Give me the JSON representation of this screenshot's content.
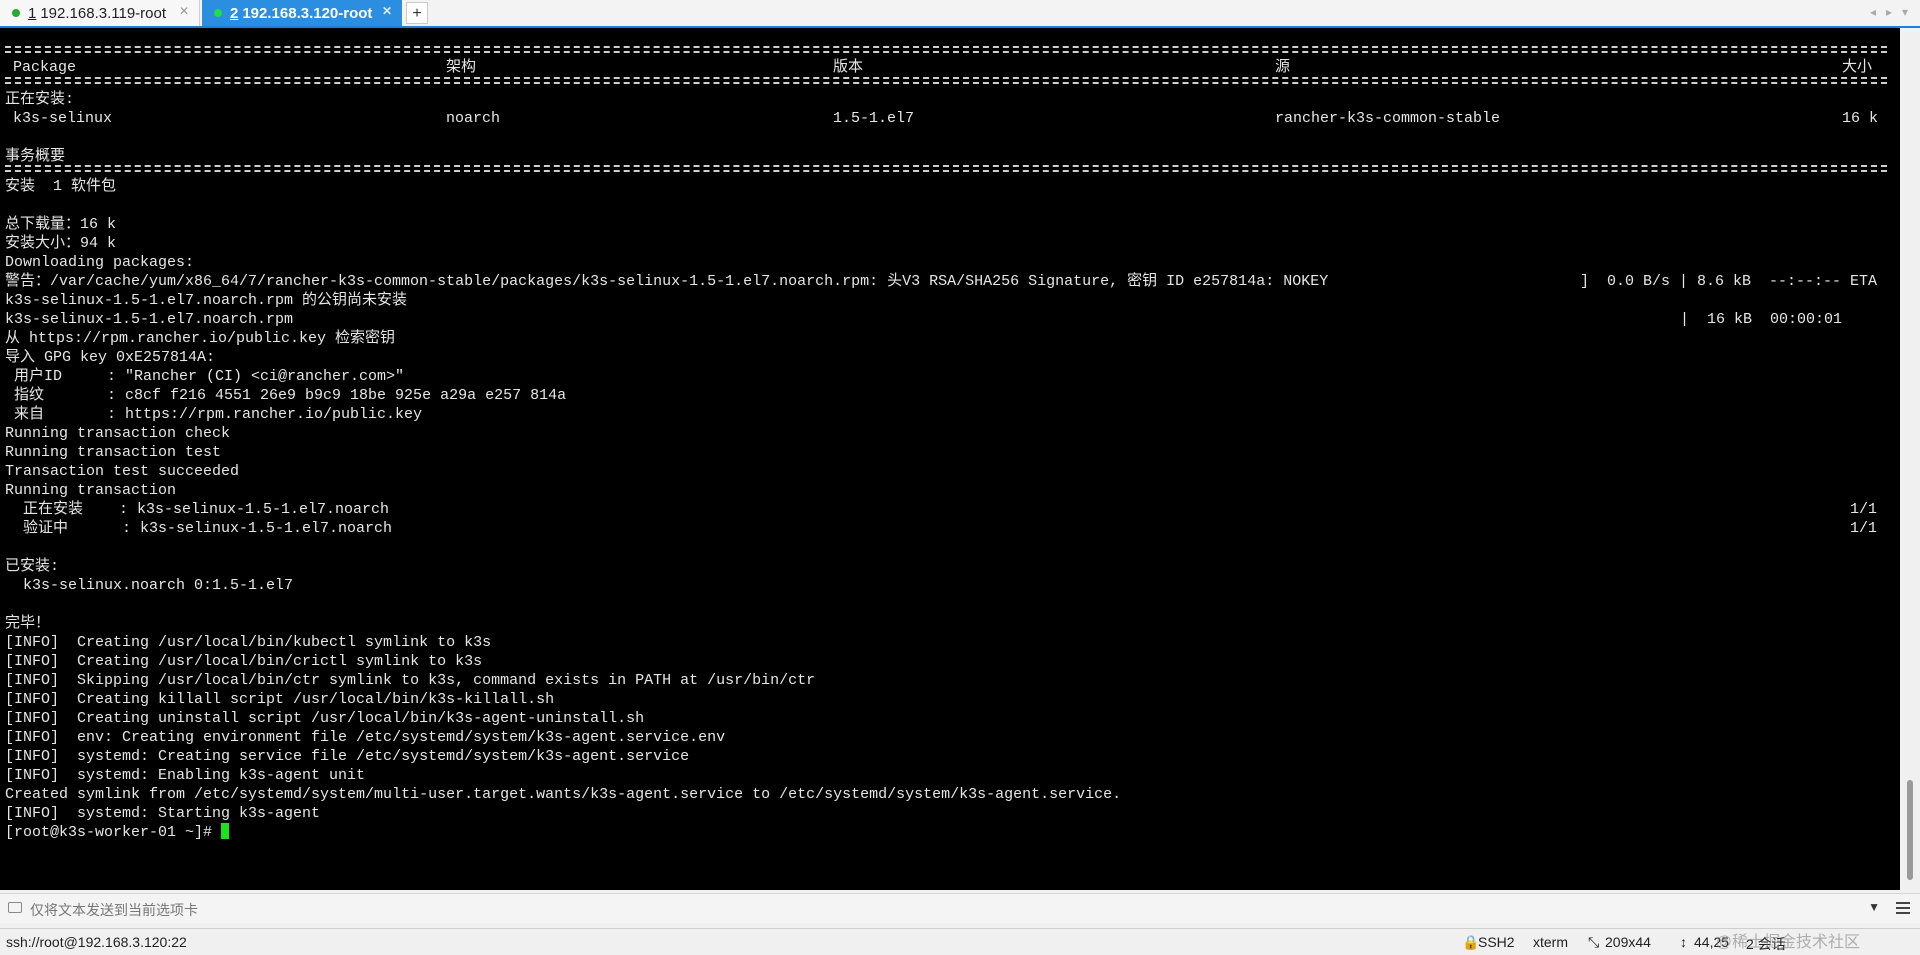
{
  "tabs": [
    {
      "number": "1",
      "label": "192.168.3.119-root"
    },
    {
      "number": "2",
      "label": "192.168.3.120-root"
    }
  ],
  "terminal": {
    "table_header": {
      "col1": "Package",
      "col2": "架构",
      "col3": "版本",
      "col4": "源",
      "col5": "大小"
    },
    "installing_label": "正在安装:",
    "package_row": {
      "col1": "k3s-selinux",
      "col2": "noarch",
      "col3": "1.5-1.el7",
      "col4": "rancher-k3s-common-stable",
      "col5": "16 k"
    },
    "summary_label": "事务概要",
    "install_count": "安装  1 软件包",
    "total_download": "总下载量：16 k",
    "install_size": "安装大小：94 k",
    "downloading": "Downloading packages:",
    "warning": "警告：/var/cache/yum/x86_64/7/rancher-k3s-common-stable/packages/k3s-selinux-1.5-1.el7.noarch.rpm: 头V3 RSA/SHA256 Signature, 密钥 ID e257814a: NOKEY",
    "warning_progress": "]  0.0 B/s | 8.6 kB  --:--:-- ETA",
    "pubkey_missing": "k3s-selinux-1.5-1.el7.noarch.rpm 的公钥尚未安装",
    "rpm_name": "k3s-selinux-1.5-1.el7.noarch.rpm",
    "rpm_progress": "|  16 kB  00:00:01",
    "retrieve_key": "从 https://rpm.rancher.io/public.key 检索密钥",
    "import_gpg": "导入 GPG key 0xE257814A:",
    "user_id": " 用户ID     : \"Rancher (CI) <ci@rancher.com>\"",
    "fingerprint": " 指纹       : c8cf f216 4551 26e9 b9c9 18be 925e a29a e257 814a",
    "from": " 来自       : https://rpm.rancher.io/public.key",
    "run_check": "Running transaction check",
    "run_test": "Running transaction test",
    "test_ok": "Transaction test succeeded",
    "run_tx": "Running transaction",
    "installing_line": "  正在安装    : k3s-selinux-1.5-1.el7.noarch",
    "installing_count": "1/1",
    "verifying_line": "  验证中      : k3s-selinux-1.5-1.el7.noarch",
    "verifying_count": "1/1",
    "installed_label": "已安装:",
    "installed_pkg": "  k3s-selinux.noarch 0:1.5-1.el7",
    "done": "完毕！",
    "info_lines": [
      "[INFO]  Creating /usr/local/bin/kubectl symlink to k3s",
      "[INFO]  Creating /usr/local/bin/crictl symlink to k3s",
      "[INFO]  Skipping /usr/local/bin/ctr symlink to k3s, command exists in PATH at /usr/bin/ctr",
      "[INFO]  Creating killall script /usr/local/bin/k3s-killall.sh",
      "[INFO]  Creating uninstall script /usr/local/bin/k3s-agent-uninstall.sh",
      "[INFO]  env: Creating environment file /etc/systemd/system/k3s-agent.service.env",
      "[INFO]  systemd: Creating service file /etc/systemd/system/k3s-agent.service",
      "[INFO]  systemd: Enabling k3s-agent unit",
      "Created symlink from /etc/systemd/system/multi-user.target.wants/k3s-agent.service to /etc/systemd/system/k3s-agent.service.",
      "[INFO]  systemd: Starting k3s-agent"
    ],
    "prompt": "[root@k3s-worker-01 ~]# "
  },
  "input_bar": {
    "placeholder": "仅将文本发送到当前选项卡"
  },
  "status_bar": {
    "connection": "ssh://root@192.168.3.120:22",
    "protocol": "SSH2",
    "terminal_type": "xterm",
    "size": "209x44",
    "cursor_pos": "44,25",
    "sessions": "2 会话"
  },
  "watermark": "@稀土掘金技术社区",
  "colors": {
    "tab_active": "#2b8ee0",
    "cursor": "#19e619",
    "terminal_bg": "#000000"
  }
}
